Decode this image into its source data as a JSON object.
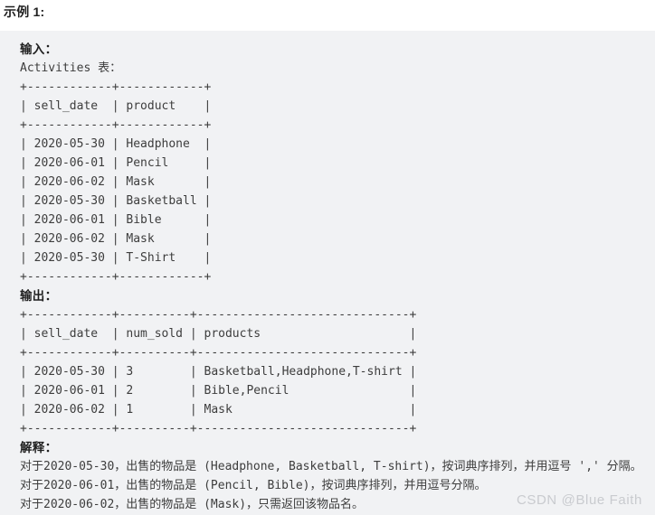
{
  "section": {
    "title": "示例 1:"
  },
  "code": {
    "input_label": "输入：",
    "input_table_caption": "Activities 表：",
    "input_table": {
      "border": "+------------+------------+",
      "header": "| sell_date  | product    |",
      "rows": [
        "| 2020-05-30 | Headphone  |",
        "| 2020-06-01 | Pencil     |",
        "| 2020-06-02 | Mask       |",
        "| 2020-05-30 | Basketball |",
        "| 2020-06-01 | Bible      |",
        "| 2020-06-02 | Mask       |",
        "| 2020-05-30 | T-Shirt    |"
      ]
    },
    "output_label": "输出：",
    "output_table": {
      "border": "+------------+----------+------------------------------+",
      "header": "| sell_date  | num_sold | products                     |",
      "rows": [
        "| 2020-05-30 | 3        | Basketball,Headphone,T-shirt |",
        "| 2020-06-01 | 2        | Bible,Pencil                 |",
        "| 2020-06-02 | 1        | Mask                         |"
      ]
    },
    "explanation_label": "解释：",
    "explanation_lines": [
      "对于2020-05-30，出售的物品是 (Headphone, Basketball, T-shirt)，按词典序排列，并用逗号 ',' 分隔。",
      "对于2020-06-01，出售的物品是 (Pencil, Bible)，按词典序排列，并用逗号分隔。",
      "对于2020-06-02，出售的物品是 (Mask)，只需返回该物品名。"
    ]
  },
  "watermark": {
    "text": "CSDN @Blue Faith"
  }
}
